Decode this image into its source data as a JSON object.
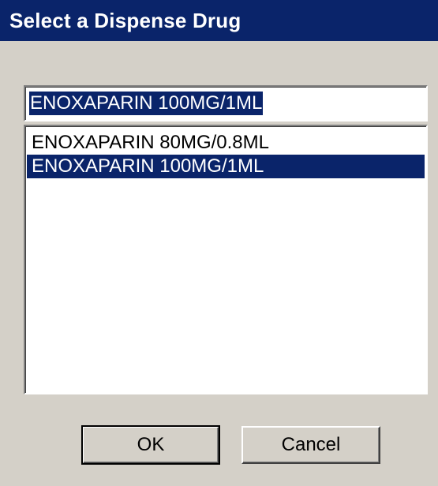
{
  "window": {
    "title": "Select a Dispense Drug"
  },
  "search": {
    "value": "ENOXAPARIN 100MG/1ML"
  },
  "list": {
    "items": [
      {
        "label": "ENOXAPARIN 80MG/0.8ML",
        "selected": false
      },
      {
        "label": "ENOXAPARIN 100MG/1ML",
        "selected": true
      }
    ]
  },
  "buttons": {
    "ok_label": "OK",
    "cancel_label": "Cancel"
  },
  "colors": {
    "titlebar": "#0a246a",
    "selection": "#0a246a",
    "face": "#d4d0c8"
  }
}
